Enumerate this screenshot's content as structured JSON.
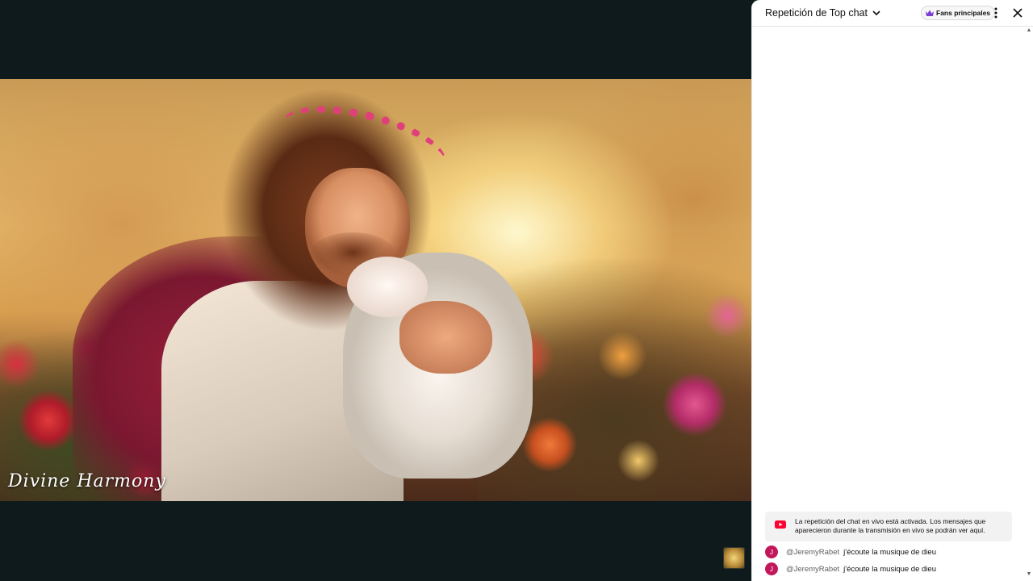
{
  "video": {
    "overlay_title": "Divine Harmony"
  },
  "chat": {
    "title": "Repetición de Top chat",
    "fans_chip": "Fans principales",
    "notice": "La repetición del chat en vivo está activada. Los mensajes que aparecieron durante la transmisión en vivo se podrán ver aquí.",
    "messages": [
      {
        "avatar": "J",
        "author": "@JeremyRabet",
        "text": "j'écoute la musique de dieu"
      },
      {
        "avatar": "J",
        "author": "@JeremyRabet",
        "text": "j'écoute la musique de dieu"
      }
    ]
  },
  "icons": {
    "title_dropdown": "chevron-down-icon",
    "fans": "crown-icon",
    "menu": "more-vert-icon",
    "close": "close-icon",
    "notice": "youtube-icon"
  },
  "colors": {
    "avatar": "#c2185b",
    "crown": "#7b3fd6",
    "youtube": "#ff0033"
  }
}
